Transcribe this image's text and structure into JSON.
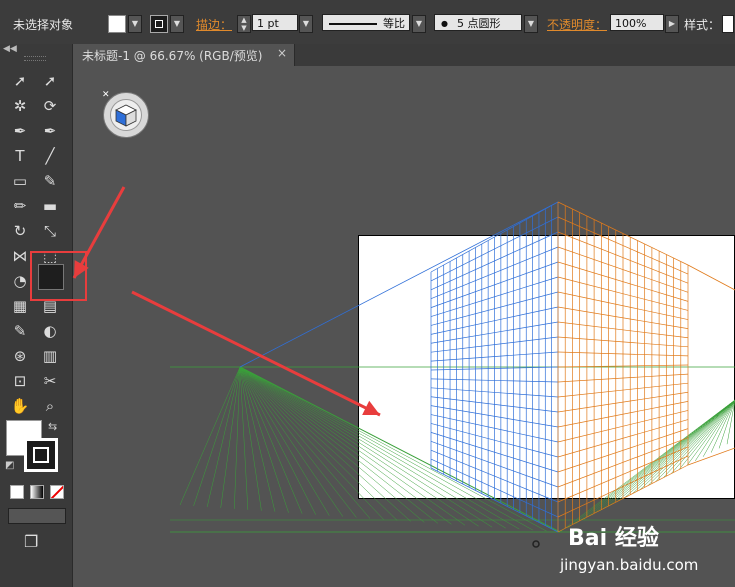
{
  "control_bar": {
    "selection_label": "未选择对象",
    "stroke_label": "描边：",
    "stroke_weight": "1 pt",
    "stroke_profile": "等比",
    "brush": "5 点圆形",
    "opacity_label": "不透明度：",
    "opacity_value": "100%",
    "style_label": "样式："
  },
  "document_tab": {
    "title": "未标题-1 @ 66.67% (RGB/预览)",
    "close": "×"
  },
  "tools": [
    {
      "name": "selection-tool",
      "icon": "➚"
    },
    {
      "name": "direct-selection-tool",
      "icon": "➚"
    },
    {
      "name": "magic-wand-tool",
      "icon": "✲"
    },
    {
      "name": "lasso-tool",
      "icon": "⟳"
    },
    {
      "name": "pen-tool",
      "icon": "✒"
    },
    {
      "name": "curvature-tool",
      "icon": "✒"
    },
    {
      "name": "type-tool",
      "icon": "T"
    },
    {
      "name": "line-segment-tool",
      "icon": "╱"
    },
    {
      "name": "rectangle-tool",
      "icon": "▭"
    },
    {
      "name": "paintbrush-tool",
      "icon": "✎"
    },
    {
      "name": "pencil-tool",
      "icon": "✏"
    },
    {
      "name": "eraser-tool",
      "icon": "▬"
    },
    {
      "name": "rotate-tool",
      "icon": "↻"
    },
    {
      "name": "scale-tool",
      "icon": "⤡"
    },
    {
      "name": "width-tool",
      "icon": "⋈"
    },
    {
      "name": "free-transform-tool",
      "icon": "⬚"
    },
    {
      "name": "shape-builder-tool",
      "icon": "◔"
    },
    {
      "name": "perspective-grid-tool",
      "icon": "▦"
    },
    {
      "name": "mesh-tool",
      "icon": "▦"
    },
    {
      "name": "gradient-tool",
      "icon": "▤"
    },
    {
      "name": "eyedropper-tool",
      "icon": "✎"
    },
    {
      "name": "blend-tool",
      "icon": "◐"
    },
    {
      "name": "symbol-sprayer-tool",
      "icon": "⊛"
    },
    {
      "name": "column-graph-tool",
      "icon": "▥"
    },
    {
      "name": "artboard-tool",
      "icon": "⊡"
    },
    {
      "name": "slice-tool",
      "icon": "✂"
    },
    {
      "name": "hand-tool",
      "icon": "✋"
    },
    {
      "name": "zoom-tool",
      "icon": "⌕"
    }
  ],
  "watermark": {
    "brand": "Bai 经验",
    "url": "jingyan.baidu.com"
  },
  "colors": {
    "left_grid": "#2f6fd8",
    "right_grid": "#e07a1a",
    "ground_grid": "#3aa03a",
    "arrow": "#e83d3d"
  }
}
